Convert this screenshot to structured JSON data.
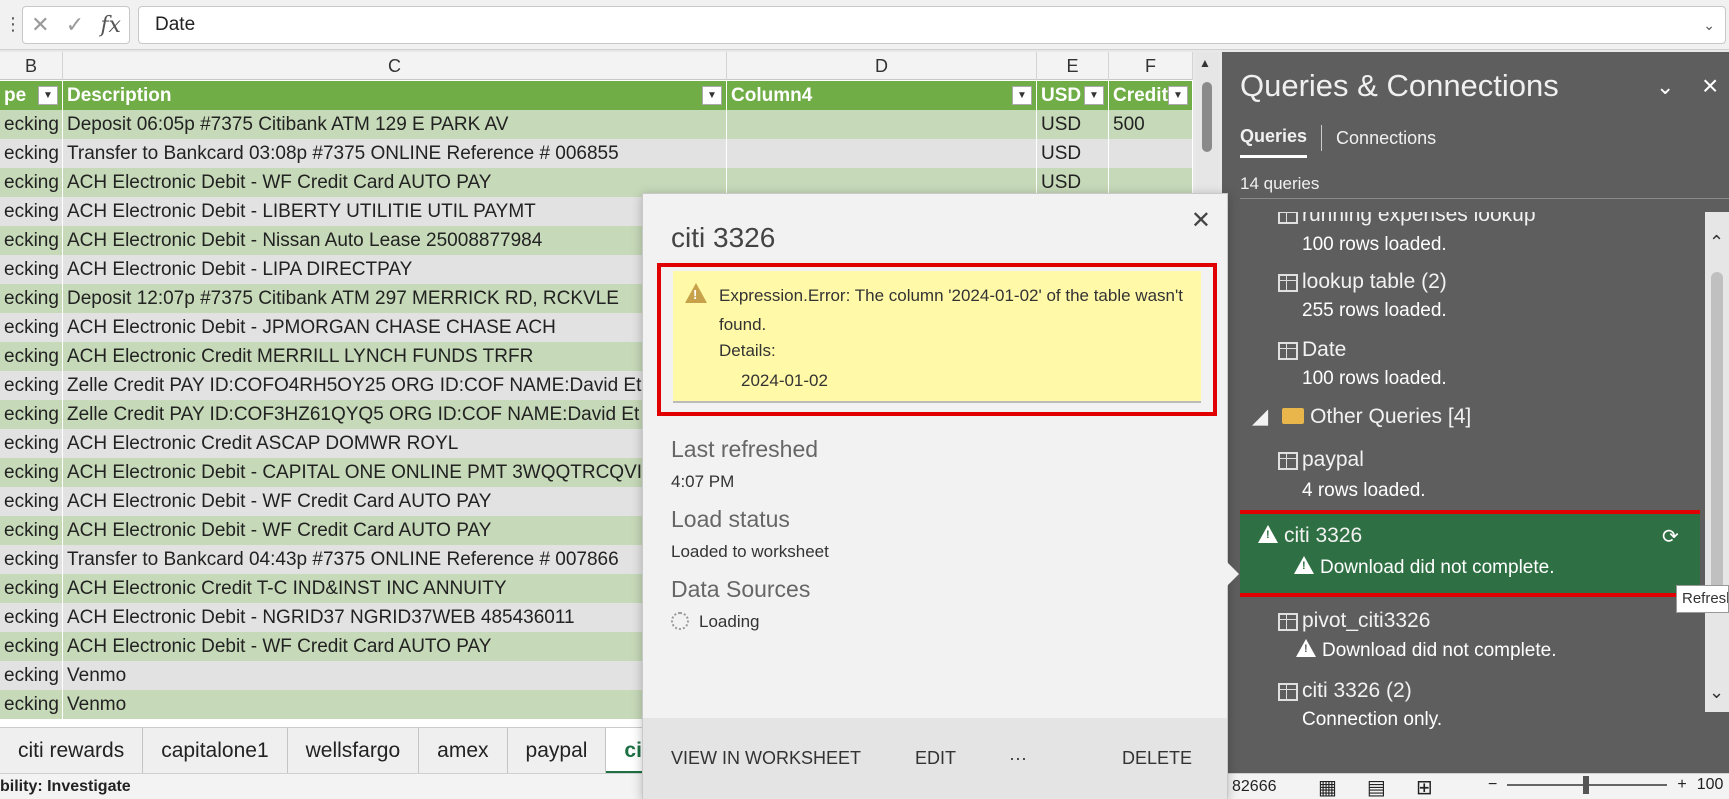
{
  "formula_bar": {
    "value": "Date"
  },
  "grid": {
    "column_letters": [
      "B",
      "C",
      "D",
      "E",
      "F"
    ],
    "headers": [
      "pe",
      "Description",
      "Column4",
      "USD",
      "Credit"
    ],
    "rows": [
      [
        "ecking",
        "Deposit 06:05p #7375 Citibank ATM 129 E PARK AV",
        "",
        "USD",
        "500"
      ],
      [
        "ecking",
        "Transfer to Bankcard 03:08p #7375 ONLINE Reference # 006855",
        "",
        "USD",
        ""
      ],
      [
        "ecking",
        "ACH Electronic Debit - WF Credit Card AUTO PAY",
        "",
        "USD",
        ""
      ],
      [
        "ecking",
        "ACH Electronic Debit - LIBERTY UTILITIE UTIL PAYMT",
        "",
        "",
        ""
      ],
      [
        "ecking",
        "ACH Electronic Debit - Nissan Auto Lease 25008877984",
        "",
        "",
        ""
      ],
      [
        "ecking",
        "ACH Electronic Debit - LIPA DIRECTPAY",
        "",
        "",
        ""
      ],
      [
        "ecking",
        "Deposit 12:07p #7375 Citibank ATM 297 MERRICK RD, RCKVLE",
        "",
        "",
        ""
      ],
      [
        "ecking",
        "ACH Electronic Debit - JPMORGAN CHASE CHASE ACH",
        "",
        "",
        ""
      ],
      [
        "ecking",
        "ACH Electronic Credit MERRILL LYNCH FUNDS TRFR",
        "",
        "",
        ""
      ],
      [
        "ecking",
        "Zelle Credit PAY ID:COFO4RH5OY25 ORG ID:COF NAME:David Et",
        "",
        "",
        ""
      ],
      [
        "ecking",
        "Zelle Credit PAY ID:COF3HZ61QYQ5 ORG ID:COF NAME:David Et",
        "",
        "",
        ""
      ],
      [
        "ecking",
        "ACH Electronic Credit ASCAP DOMWR ROYL",
        "",
        "",
        ""
      ],
      [
        "ecking",
        "ACH Electronic Debit - CAPITAL ONE ONLINE PMT 3WQQTRCQVI",
        "",
        "",
        ""
      ],
      [
        "ecking",
        "ACH Electronic Debit - WF Credit Card AUTO PAY",
        "",
        "",
        ""
      ],
      [
        "ecking",
        "ACH Electronic Debit - WF Credit Card AUTO PAY",
        "",
        "",
        ""
      ],
      [
        "ecking",
        "Transfer to Bankcard 04:43p #7375 ONLINE Reference # 007866",
        "",
        "",
        ""
      ],
      [
        "ecking",
        "ACH Electronic Credit T-C IND&INST INC ANNUITY",
        "",
        "",
        ""
      ],
      [
        "ecking",
        "ACH Electronic Debit - NGRID37 NGRID37WEB 485436011",
        "",
        "",
        ""
      ],
      [
        "ecking",
        "ACH Electronic Debit - WF Credit Card AUTO PAY",
        "",
        "",
        ""
      ],
      [
        "ecking",
        "Venmo",
        "",
        "",
        ""
      ],
      [
        "ecking",
        "Venmo",
        "",
        "",
        ""
      ]
    ],
    "colors": {
      "header_green": "#70ad47",
      "band_green": "#c6d9b8",
      "band_grey": "#e2e2e2"
    }
  },
  "sheet_tabs": [
    "citi rewards",
    "capitalone1",
    "wellsfargo",
    "amex",
    "paypal",
    "citi"
  ],
  "status_bar": {
    "left": "bility: Investigate",
    "count": "82666",
    "zoom": "100"
  },
  "queries_pane": {
    "title": "Queries & Connections",
    "tabs": [
      "Queries",
      "Connections"
    ],
    "count": "14 queries",
    "items": [
      {
        "name": "running expenses lookup",
        "status": "100 rows loaded."
      },
      {
        "name": "lookup table (2)",
        "status": "255 rows loaded."
      },
      {
        "name": "Date",
        "status": "100 rows loaded."
      },
      {
        "group": "Other Queries [4]"
      },
      {
        "name": "paypal",
        "status": "4 rows loaded."
      },
      {
        "name": "citi 3326",
        "status": "Download did not complete.",
        "selected": true
      },
      {
        "name": "pivot_citi3326",
        "status": "Download did not complete."
      },
      {
        "name": "citi 3326 (2)",
        "status": "Connection only."
      }
    ],
    "tooltip": "Refresh",
    "colors": {
      "pane_bg": "#5e5e5e",
      "selected_bg": "#2e7043",
      "highlight_red": "#e00000"
    }
  },
  "flyout": {
    "title": "citi 3326",
    "error_message": "Expression.Error: The column '2024-01-02' of the table wasn't found.",
    "details_label": "Details:",
    "details_value": "2024-01-02",
    "last_refreshed_label": "Last refreshed",
    "last_refreshed_value": "4:07 PM",
    "load_status_label": "Load status",
    "load_status_value": "Loaded to worksheet",
    "data_sources_label": "Data Sources",
    "data_sources_value": "Loading",
    "actions": [
      "VIEW IN WORKSHEET",
      "EDIT",
      "···",
      "DELETE"
    ],
    "colors": {
      "error_bg": "#fff9a8"
    }
  }
}
